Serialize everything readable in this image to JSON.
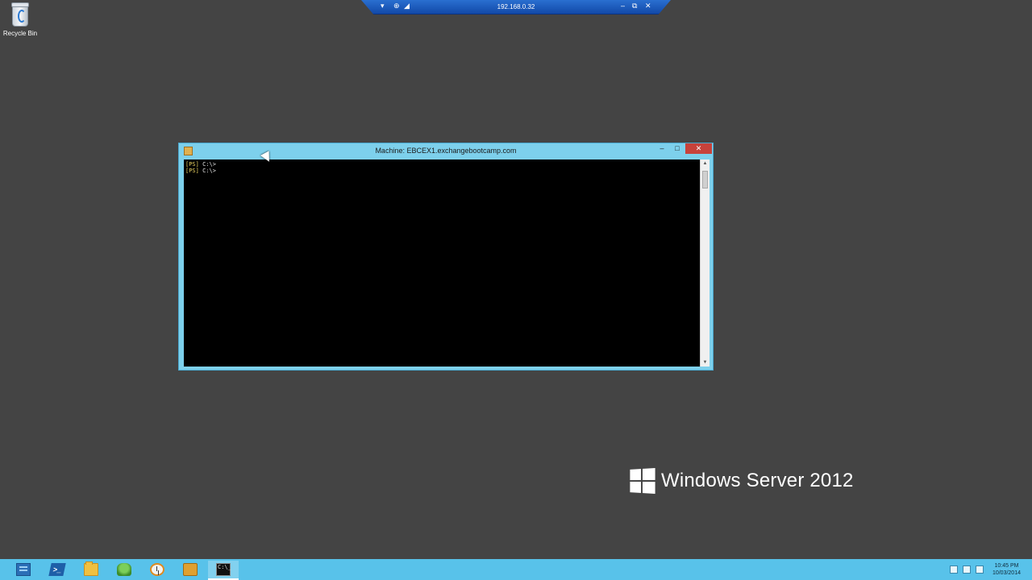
{
  "remote_bar": {
    "host": "192.168.0.32",
    "pin_icon": "▾",
    "minimize_icon": "‒",
    "restore_icon": "⧉",
    "close_icon": "✕"
  },
  "desktop": {
    "icons": [
      {
        "label": "Recycle Bin",
        "icon": "recycle-bin-icon"
      }
    ]
  },
  "console_window": {
    "title": "Machine: EBCEX1.exchangebootcamp.com",
    "min_label": "–",
    "max_label": "□",
    "close_label": "✕",
    "lines": [
      {
        "prompt": "[PS]",
        "path": " C:\\>"
      },
      {
        "prompt": "[PS]",
        "path": " C:\\>"
      }
    ],
    "scroll_up": "▲",
    "scroll_down": "▼"
  },
  "watermark": {
    "text": "Windows Server 2012"
  },
  "taskbar": {
    "apps": [
      {
        "name": "server-manager",
        "icon": "server-manager-icon",
        "glyph": ""
      },
      {
        "name": "powershell",
        "icon": "powershell-icon",
        "glyph": ">_"
      },
      {
        "name": "file-explorer",
        "icon": "folder-icon",
        "glyph": ""
      },
      {
        "name": "app-green",
        "icon": "tree-icon",
        "glyph": ""
      },
      {
        "name": "app-clock",
        "icon": "clock-icon",
        "glyph": ""
      },
      {
        "name": "app-tools",
        "icon": "tools-icon",
        "glyph": ""
      },
      {
        "name": "command-prompt",
        "icon": "cmd-icon",
        "glyph": "C:\\_"
      }
    ],
    "tray_icons": [
      "flag-icon",
      "network-icon",
      "volume-icon"
    ],
    "time": "10:45 PM",
    "date": "10/03/2014"
  },
  "colors": {
    "desktop_bg": "#444444",
    "taskbar": "#58c2ea",
    "window_frame": "#7dd0ec",
    "close_button": "#c7423b"
  }
}
